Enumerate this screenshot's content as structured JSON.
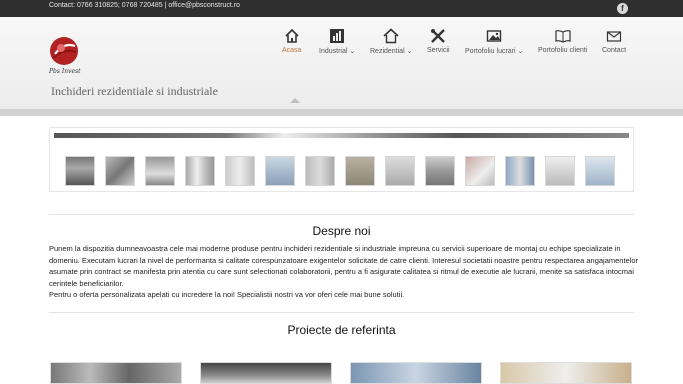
{
  "topbar": {
    "contact": "Contact: 0766 310825; 0768 720485 | office@pbsconstruct.ro",
    "social_icon": "facebook-icon"
  },
  "header": {
    "logo_text": "Pbs Invest",
    "tagline": "Inchideri rezidentiale si industriale"
  },
  "nav": [
    {
      "label": "Acasa",
      "icon": "home-icon",
      "active": true,
      "dropdown": false
    },
    {
      "label": "Industrial",
      "icon": "bar-chart-icon",
      "active": false,
      "dropdown": true
    },
    {
      "label": "Rezidential",
      "icon": "house-icon",
      "active": false,
      "dropdown": true
    },
    {
      "label": "Servicii",
      "icon": "tools-icon",
      "active": false,
      "dropdown": false
    },
    {
      "label": "Portofoliu lucrari",
      "icon": "picture-icon",
      "active": false,
      "dropdown": true
    },
    {
      "label": "Portofoliu clienti",
      "icon": "book-icon",
      "active": false,
      "dropdown": false
    },
    {
      "label": "Contact",
      "icon": "envelope-icon",
      "active": false,
      "dropdown": false
    }
  ],
  "colors": {
    "accent": "#c0793a",
    "topbar": "#2f2f2f"
  },
  "about": {
    "title": "Despre noi",
    "text": "Punem la dispozitia dumneavoastra cele mai moderne produse pentru inchideri rezidentiale si industriale impreuna cu servicii superioare de montaj cu echipe specializate in domeniu. Executam lucrari la nivel de performanta si calitate corespunzatoare exigentelor solicitate de catre clienti. Interesul societatii noastre pentru respectarea angajamentelor asumate prin contract se manifesta prin atentia cu care sunt selectionati colaboratorii, pentru a fi asigurate calitatea si ritmul de executie ale lucrarii, menite sa satisfaca intocmai cerintele beneficiarilor.",
    "text2": "Pentru o oferta personalizata apelati cu incredere la noi! Specialistii nostri va vor oferi cele mai bune solutii."
  },
  "projects": {
    "title": "Proiecte de referinta"
  }
}
